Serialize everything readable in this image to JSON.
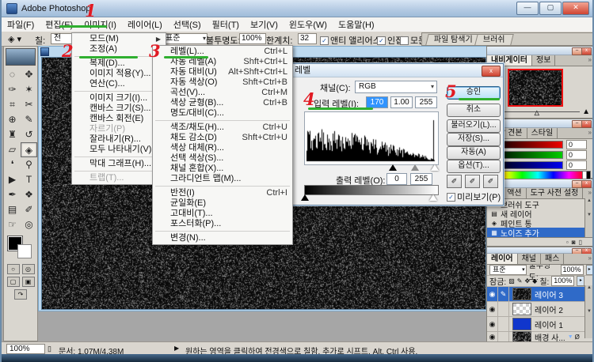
{
  "window": {
    "title": "Adobe Photoshop"
  },
  "menu_bar": {
    "items": [
      "파일(F)",
      "편집(E)",
      "이미지(I)",
      "레이어(L)",
      "선택(S)",
      "필터(T)",
      "보기(V)",
      "윈도우(W)",
      "도움말(H)"
    ]
  },
  "options_bar": {
    "tool_icon": "paint-bucket-icon",
    "fill_label": "칠:",
    "fill_value": "전",
    "mode_value": "표준",
    "opacity_label": "불투명도:",
    "opacity_value": "100%",
    "tolerance_label": "한계치:",
    "tolerance_value": "32",
    "checks": [
      {
        "label": "앤티 앨리어스",
        "checked": true
      },
      {
        "label": "인접",
        "checked": true
      },
      {
        "label": "모든 레이어",
        "checked": false
      }
    ],
    "well_tabs": [
      "파일 탐색기",
      "브러쉬"
    ]
  },
  "image_menu": {
    "items": [
      {
        "label": "모드(M)",
        "submenu": true
      },
      {
        "label": "조정(A)",
        "submenu": true
      },
      {
        "sep": true
      },
      {
        "label": "복제(D)..."
      },
      {
        "label": "이미지 적용(Y)..."
      },
      {
        "label": "연산(C)..."
      },
      {
        "sep": true
      },
      {
        "label": "이미지 크기(I)..."
      },
      {
        "label": "캔바스 크기(S)..."
      },
      {
        "label": "캔바스 회전(E)",
        "submenu": true
      },
      {
        "label": "자르기(P)",
        "disabled": true
      },
      {
        "label": "잘라내기(R)..."
      },
      {
        "label": "모두 나타내기(V)"
      },
      {
        "sep": true
      },
      {
        "label": "막대 그래프(H)..."
      },
      {
        "sep": true
      },
      {
        "label": "트랩(T)...",
        "disabled": true
      }
    ]
  },
  "adjust_submenu": {
    "items": [
      {
        "label": "레벨(L)...",
        "shortcut": "Ctrl+L"
      },
      {
        "label": "자동 레벨(A)",
        "shortcut": "Shft+Ctrl+L"
      },
      {
        "label": "자동 대비(U)",
        "shortcut": "Alt+Shft+Ctrl+L"
      },
      {
        "label": "자동 색상(O)",
        "shortcut": "Shft+Ctrl+B"
      },
      {
        "label": "곡선(V)...",
        "shortcut": "Ctrl+M"
      },
      {
        "label": "색상 균형(B)...",
        "shortcut": "Ctrl+B"
      },
      {
        "label": "명도/대비(C)..."
      },
      {
        "sep": true
      },
      {
        "label": "색조/채도(H)...",
        "shortcut": "Ctrl+U"
      },
      {
        "label": "채도 감소(D)",
        "shortcut": "Shft+Ctrl+U"
      },
      {
        "label": "색상 대체(R)..."
      },
      {
        "label": "선택 색상(S)..."
      },
      {
        "label": "채널 혼합(X)..."
      },
      {
        "label": "그라디언트 맵(M)..."
      },
      {
        "sep": true
      },
      {
        "label": "반전(I)",
        "shortcut": "Ctrl+I"
      },
      {
        "label": "균일화(E)"
      },
      {
        "label": "고대비(T)..."
      },
      {
        "label": "포스터화(P)..."
      },
      {
        "sep": true
      },
      {
        "label": "변경(N)..."
      }
    ]
  },
  "levels_dialog": {
    "title": "레벨",
    "channel_label": "채널(C):",
    "channel_value": "RGB",
    "input_label": "입력 레벨(I):",
    "input_values": [
      "170",
      "1.00",
      "255"
    ],
    "output_label": "출력 레벨(O):",
    "output_values": [
      "0",
      "255"
    ],
    "buttons": {
      "ok": "승인",
      "cancel": "취소",
      "load": "불러오기(L)...",
      "save": "저장(S)...",
      "auto": "자동(A)",
      "options": "옵션(T)..."
    },
    "preview_label": "미리보기(P)",
    "preview_checked": true
  },
  "panels": {
    "navigator": {
      "tabs": [
        "내비게이터",
        "정보"
      ]
    },
    "color": {
      "tabs": [
        "색상 견본",
        "스타일"
      ],
      "values": [
        "0",
        "0",
        "0"
      ]
    },
    "history": {
      "tab_partial": "역",
      "tabs": [
        "액션",
        "도구 사전 설정"
      ],
      "items": [
        {
          "label": "브러쉬 도구"
        },
        {
          "label": "새 레이어"
        },
        {
          "label": "페인트 통"
        },
        {
          "label": "노이즈 추가",
          "selected": true
        }
      ]
    },
    "layers": {
      "tabs": [
        "레이어",
        "채널",
        "패스"
      ],
      "blend_mode": "표준",
      "opacity_label": "불투명도:",
      "opacity_value": "100%",
      "lock_label": "잠금:",
      "fill_label": "칠:",
      "fill_value": "100%",
      "rows": [
        {
          "name": "레이어 3",
          "selected": true
        },
        {
          "name": "레이어 2"
        },
        {
          "name": "레이어 1"
        },
        {
          "name": "배경 사..."
        }
      ]
    }
  },
  "status_bar": {
    "zoom": "100%",
    "doc_info": "문서: 1.07M/4.38M",
    "tip_arrow": "▶",
    "tip": "원하는 영역을 클릭하여 전경색으로 칠함. 추가로 시프트, Alt, Ctrl 사용."
  },
  "toolbox": {
    "tools": [
      {
        "name": "marquee-tool-icon",
        "glyph": "◌"
      },
      {
        "name": "move-tool-icon",
        "glyph": "✥"
      },
      {
        "name": "lasso-tool-icon",
        "glyph": "✑"
      },
      {
        "name": "magic-wand-tool-icon",
        "glyph": "✶"
      },
      {
        "name": "crop-tool-icon",
        "glyph": "⌗"
      },
      {
        "name": "slice-tool-icon",
        "glyph": "✂"
      },
      {
        "name": "healing-brush-tool-icon",
        "glyph": "⊕"
      },
      {
        "name": "brush-tool-icon",
        "glyph": "✎"
      },
      {
        "name": "clone-stamp-tool-icon",
        "glyph": "♜"
      },
      {
        "name": "history-brush-tool-icon",
        "glyph": "↺"
      },
      {
        "name": "eraser-tool-icon",
        "glyph": "▱"
      },
      {
        "name": "paint-bucket-tool-icon",
        "glyph": "◈",
        "selected": true
      },
      {
        "name": "blur-tool-icon",
        "glyph": "❛"
      },
      {
        "name": "dodge-tool-icon",
        "glyph": "⚲"
      },
      {
        "name": "path-select-tool-icon",
        "glyph": "▶"
      },
      {
        "name": "type-tool-icon",
        "glyph": "T"
      },
      {
        "name": "pen-tool-icon",
        "glyph": "✒"
      },
      {
        "name": "shape-tool-icon",
        "glyph": "❖"
      },
      {
        "name": "notes-tool-icon",
        "glyph": "▤"
      },
      {
        "name": "eyedropper-tool-icon",
        "glyph": "✐"
      },
      {
        "name": "hand-tool-icon",
        "glyph": "☞"
      },
      {
        "name": "zoom-tool-icon",
        "glyph": "◎"
      }
    ]
  },
  "annotations": {
    "steps": [
      "1",
      "2",
      "3",
      "4",
      "5"
    ],
    "accent": "#e01b24",
    "underline": "#2faf2f"
  },
  "colors": {
    "selection_blue": "#2f6ac8",
    "input_highlight": "#3194ff",
    "navigator_border": "#ee1111",
    "layer1_blue": "#1036cc"
  }
}
